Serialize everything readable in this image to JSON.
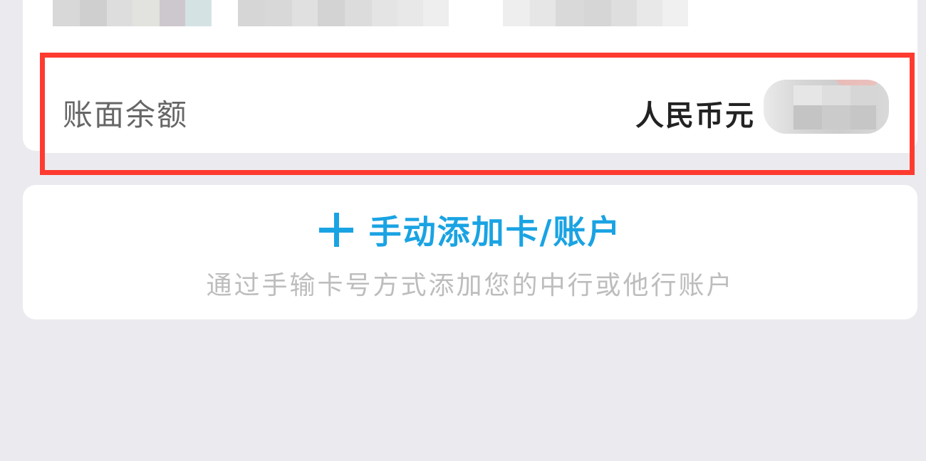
{
  "balance": {
    "label": "账面余额",
    "currency": "人民币元"
  },
  "add_account": {
    "title": "手动添加卡/账户",
    "subtitle": "通过手输卡号方式添加您的中行或他行账户"
  },
  "colors": {
    "accent": "#1aa3e3",
    "highlight": "#ff3b30",
    "background": "#ebebef"
  },
  "icons": {
    "add": "plus-icon"
  }
}
